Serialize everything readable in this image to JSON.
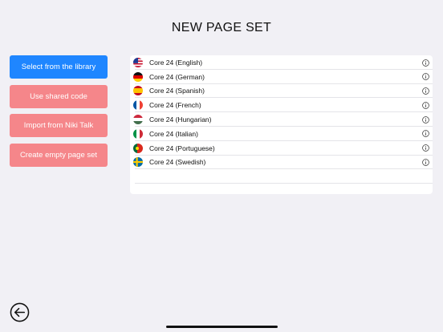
{
  "header": {
    "title": "NEW PAGE SET"
  },
  "actions": {
    "select_library": "Select from the library",
    "shared_code": "Use shared code",
    "import_niki": "Import from Niki Talk",
    "empty_set": "Create empty page set"
  },
  "colors": {
    "primary": "#1f86ff",
    "secondary": "#f5868a",
    "background": "#f1f0f5"
  },
  "page_sets": [
    {
      "label": "Core 24 (English)",
      "flag": "us-flag-icon"
    },
    {
      "label": "Core 24 (German)",
      "flag": "de-flag-icon"
    },
    {
      "label": "Core 24 (Spanish)",
      "flag": "es-flag-icon"
    },
    {
      "label": "Core 24 (French)",
      "flag": "fr-flag-icon"
    },
    {
      "label": "Core 24 (Hungarian)",
      "flag": "hu-flag-icon"
    },
    {
      "label": "Core 24 (Italian)",
      "flag": "it-flag-icon"
    },
    {
      "label": "Core 24 (Portuguese)",
      "flag": "pt-flag-icon"
    },
    {
      "label": "Core 24 (Swedish)",
      "flag": "se-flag-icon"
    }
  ],
  "footer": {
    "back_icon": "arrow-left-circle-icon"
  }
}
